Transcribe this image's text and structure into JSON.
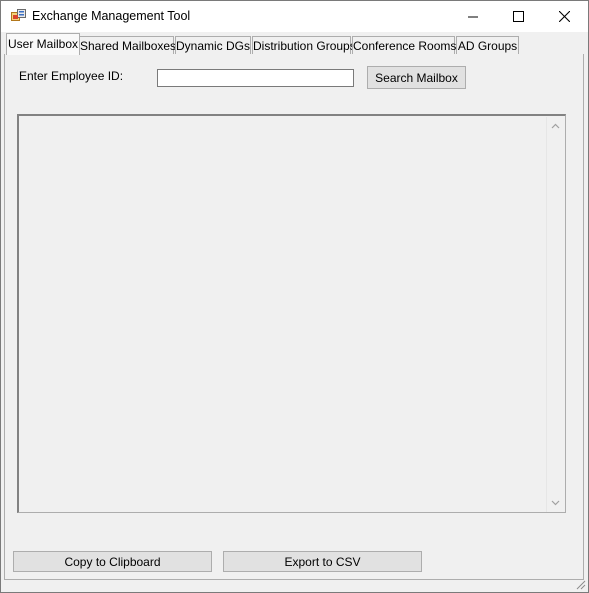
{
  "window": {
    "title": "Exchange Management Tool",
    "icons": [
      "app-icon",
      "minimize-icon",
      "maximize-icon",
      "close-icon"
    ]
  },
  "tabs": [
    {
      "label": "User Mailbox",
      "active": true
    },
    {
      "label": "Shared Mailboxes",
      "active": false
    },
    {
      "label": "Dynamic DGs",
      "active": false
    },
    {
      "label": "Distribution Groups",
      "active": false
    },
    {
      "label": "Conference Rooms",
      "active": false
    },
    {
      "label": "AD Groups",
      "active": false
    }
  ],
  "search": {
    "label": "Enter Employee ID:",
    "value": "",
    "placeholder": "",
    "button_label": "Search Mailbox"
  },
  "results": {
    "text": "",
    "scrollbar_icons": [
      "scroll-up-icon",
      "scroll-down-icon"
    ]
  },
  "actions": {
    "copy_label": "Copy to Clipboard",
    "export_label": "Export to CSV"
  },
  "colors": {
    "window_bg": "#f0f0f0",
    "titlebar_bg": "#ffffff",
    "button_bg": "#e1e1e1",
    "border": "#adadad"
  }
}
